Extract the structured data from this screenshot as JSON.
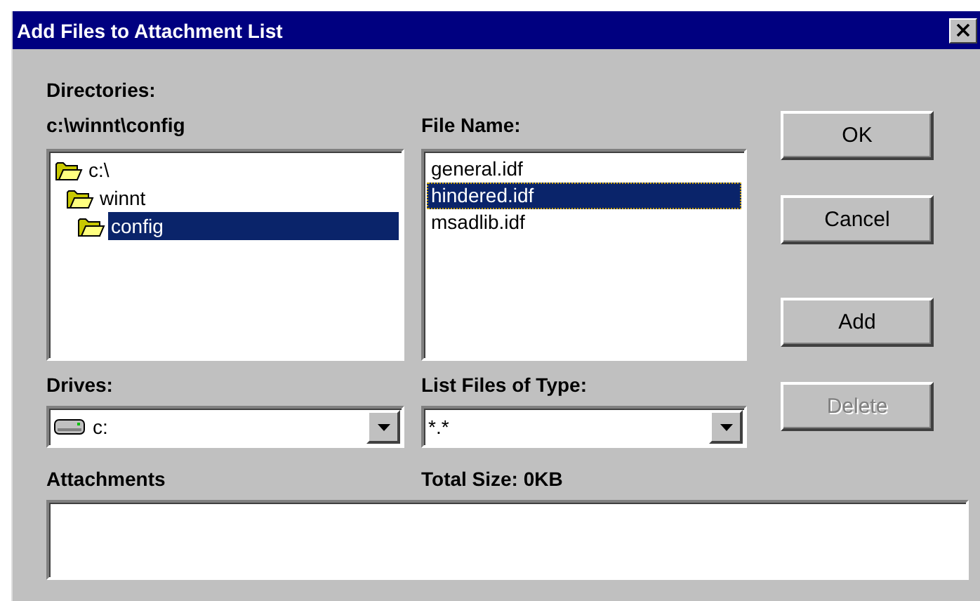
{
  "window": {
    "title": "Add Files to Attachment List"
  },
  "directories": {
    "label": "Directories:",
    "path": "c:\\winnt\\config",
    "items": [
      {
        "name": "c:\\",
        "selected": false,
        "children": [
          {
            "name": "winnt",
            "selected": false,
            "children": [
              {
                "name": "config",
                "selected": true
              }
            ]
          }
        ]
      }
    ]
  },
  "files": {
    "label": "File Name:",
    "items": [
      {
        "name": "general.idf",
        "selected": false
      },
      {
        "name": "hindered.idf",
        "selected": true
      },
      {
        "name": "msadlib.idf",
        "selected": false
      }
    ]
  },
  "drives": {
    "label": "Drives:",
    "value": "c:"
  },
  "file_type": {
    "label": "List Files of Type:",
    "value": "*.*"
  },
  "buttons": [
    {
      "label": "OK",
      "disabled": false
    },
    {
      "label": "Cancel",
      "disabled": false
    },
    {
      "label": "Add",
      "disabled": false
    },
    {
      "label": "Delete",
      "disabled": true
    }
  ],
  "attachments": {
    "label": "Attachments",
    "total_size": "Total Size: 0KB"
  }
}
